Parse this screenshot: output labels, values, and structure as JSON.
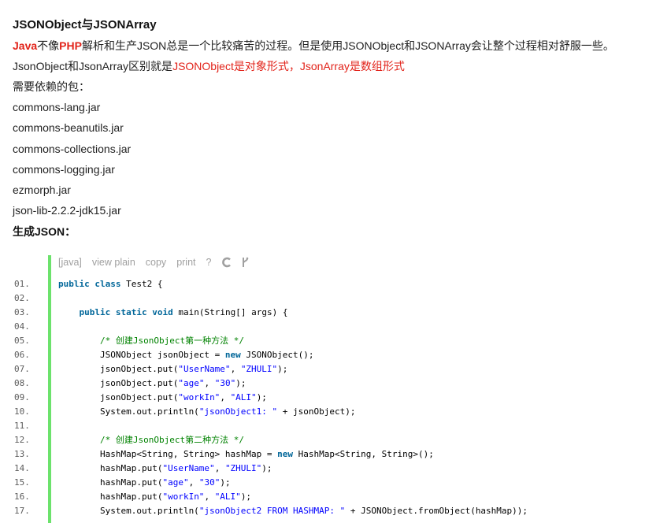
{
  "article": {
    "title": "JSONObject与JSONArray",
    "intro": {
      "java": "Java",
      "t1": "不像",
      "php": "PHP",
      "t2": "解析和生产JSON总是一个比较痛苦的过程。但是使用JSONObject和JSONArray会让整个过程相对舒服一些。"
    },
    "diff": {
      "t1": "JsonObject和JsonArray区别就是",
      "red": "JSONObject是对象形式，JsonArray是数组形式"
    },
    "deps_heading": "需要依赖的包：",
    "deps": [
      "commons-lang.jar",
      "commons-beanutils.jar",
      "commons-collections.jar",
      "commons-logging.jar",
      "ezmorph.jar",
      "json-lib-2.2.2-jdk15.jar"
    ],
    "section_heading": "生成JSON："
  },
  "code": {
    "toolbar": {
      "lang": "[java]",
      "view_plain": "view plain",
      "copy": "copy",
      "print": "print",
      "help": "?"
    },
    "line_numbers": [
      "01.",
      "02.",
      "03.",
      "04.",
      "05.",
      "06.",
      "07.",
      "08.",
      "09.",
      "10.",
      "11.",
      "12.",
      "13.",
      "14.",
      "15.",
      "16.",
      "17."
    ]
  },
  "colors": {
    "accent_red": "#e2231a",
    "code_bar": "#6ce26c",
    "keyword": "#006699",
    "string": "#0000ff",
    "comment": "#008200"
  }
}
